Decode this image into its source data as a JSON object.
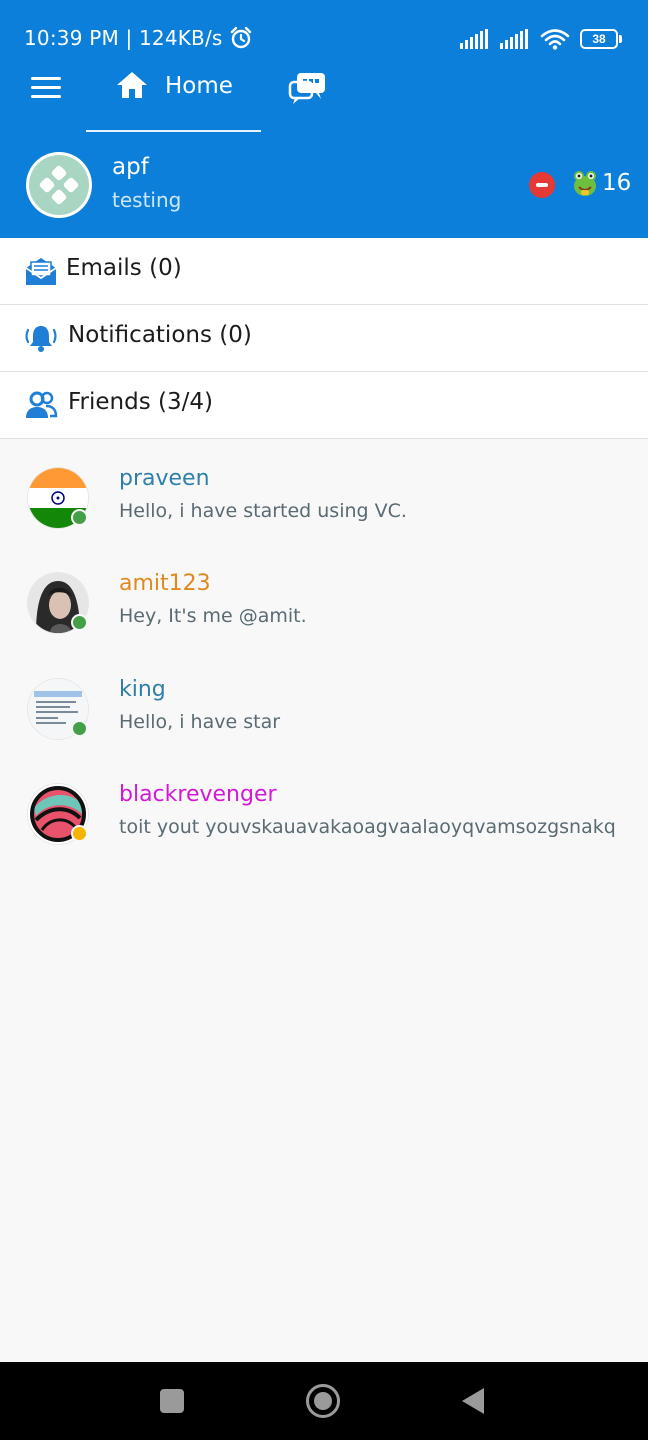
{
  "status_bar": {
    "time_speed": "10:39 PM | 124KB/s",
    "battery": "38",
    "icons": [
      "alarm-icon",
      "signal-icon",
      "signal-icon",
      "wifi-icon",
      "battery-icon"
    ]
  },
  "header": {
    "bg_color": "#0c7fdb",
    "home_tab_label": "Home",
    "icons": [
      "menu-icon",
      "home-icon",
      "chat-icon"
    ]
  },
  "profile": {
    "name": "apf",
    "subtitle": "testing",
    "status_color": "#e53935",
    "coins": "16"
  },
  "sections": {
    "emails": "Emails (0)",
    "notifications": "Notifications (0)",
    "friends": "Friends (3/4)"
  },
  "friends": [
    {
      "name": "praveen",
      "message": "Hello, i have started using VC.",
      "name_color": "#2f7fa8",
      "presence_color": "#43a047"
    },
    {
      "name": "amit123",
      "message": "Hey, It's me @amit.",
      "name_color": "#e08a1e",
      "presence_color": "#43a047"
    },
    {
      "name": "king",
      "message": "Hello, i have star",
      "name_color": "#2f7fa8",
      "presence_color": "#43a047"
    },
    {
      "name": "blackrevenger",
      "message": "toit yout youvskauavakaoagvaalaoyqvamsozgsnakq",
      "name_color": "#d21ad6",
      "presence_color": "#f5b400"
    }
  ]
}
